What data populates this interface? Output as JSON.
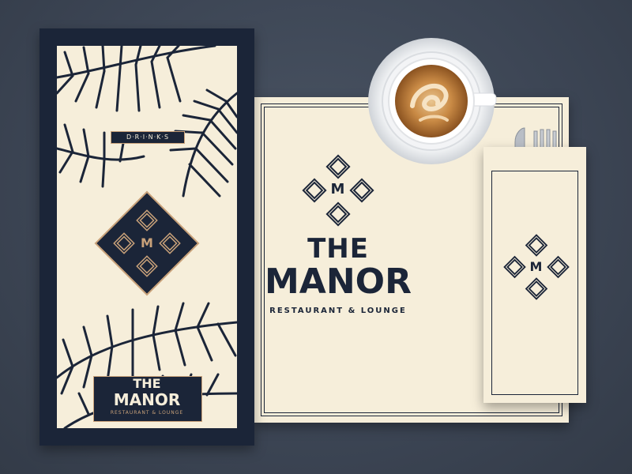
{
  "menu": {
    "section_label": "D·R·I·N·K·S",
    "monogram": "M",
    "logo_line1": "THE",
    "logo_line2": "MANOR",
    "tagline": "RESTAURANT & LOUNGE"
  },
  "placemat": {
    "monogram": "M",
    "logo_line1": "THE",
    "logo_line2": "MANOR",
    "tagline": "RESTAURANT & LOUNGE"
  },
  "napkin_sleeve": {
    "monogram": "M"
  },
  "colors": {
    "navy": "#1b2538",
    "cream": "#f6eeda",
    "gold": "#c9a27a",
    "background": "#3c4554"
  }
}
